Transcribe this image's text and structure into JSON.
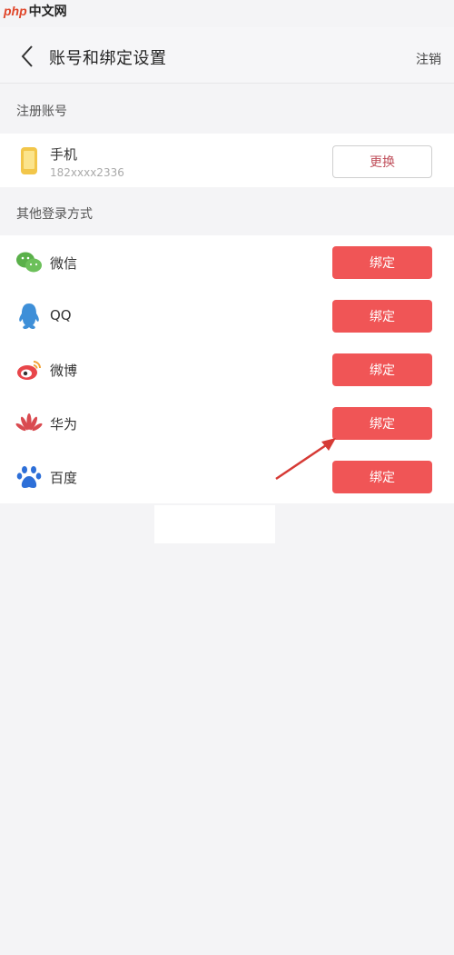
{
  "watermark": {
    "logo": "php",
    "text": "中文网"
  },
  "header": {
    "title": "账号和绑定设置",
    "logout": "注销"
  },
  "sections": {
    "registered": "注册账号",
    "others": "其他登录方式"
  },
  "phone": {
    "label": "手机",
    "number": "182xxxx2336",
    "change_button": "更换"
  },
  "logins": [
    {
      "name": "微信",
      "button": "绑定",
      "icon": "wechat-icon"
    },
    {
      "name": "QQ",
      "button": "绑定",
      "icon": "qq-icon"
    },
    {
      "name": "微博",
      "button": "绑定",
      "icon": "weibo-icon"
    },
    {
      "name": "华为",
      "button": "绑定",
      "icon": "huawei-icon"
    },
    {
      "name": "百度",
      "button": "绑定",
      "icon": "baidu-icon"
    }
  ],
  "colors": {
    "accent": "#f05556",
    "background": "#f4f4f6",
    "annotation_arrow": "#d63a35"
  }
}
